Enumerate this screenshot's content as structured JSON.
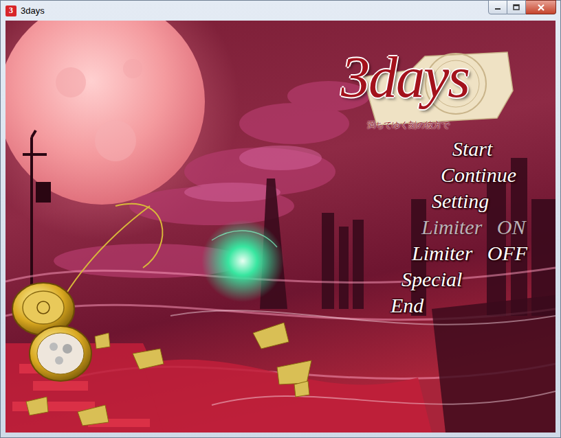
{
  "window": {
    "title": "3days",
    "icon_text": "3"
  },
  "logo": {
    "title": "3days",
    "subtitle": "満ちてゆく刻の彼方で"
  },
  "menu": [
    {
      "label": "Start",
      "dimmed": false
    },
    {
      "label": "Continue",
      "dimmed": false
    },
    {
      "label": "Setting",
      "dimmed": false
    },
    {
      "label": "Limiter ON",
      "dimmed": true
    },
    {
      "label": "Limiter OFF",
      "dimmed": false
    },
    {
      "label": "Special",
      "dimmed": false
    },
    {
      "label": "End",
      "dimmed": false
    }
  ]
}
